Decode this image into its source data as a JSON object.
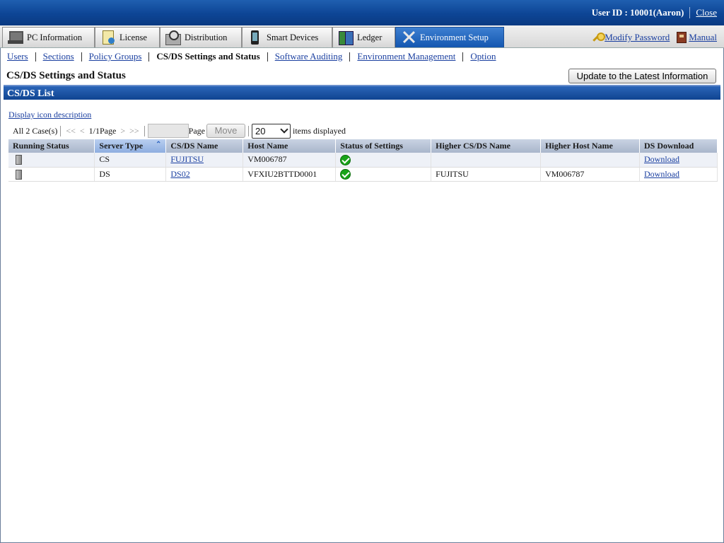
{
  "header": {
    "user_label": "User ID :",
    "user_value": "10001(Aaron)",
    "close_label": "Close"
  },
  "tabs": [
    {
      "label": "PC Information",
      "icon": "pc-icon"
    },
    {
      "label": "License",
      "icon": "license-icon"
    },
    {
      "label": "Distribution",
      "icon": "distribution-icon"
    },
    {
      "label": "Smart Devices",
      "icon": "smart-device-icon"
    },
    {
      "label": "Ledger",
      "icon": "ledger-icon"
    },
    {
      "label": "Environment Setup",
      "icon": "tools-icon",
      "active": true
    }
  ],
  "toplinks": {
    "modify_password": "Modify Password",
    "manual": "Manual"
  },
  "submenu": {
    "users": "Users",
    "sections": "Sections",
    "policy_groups": "Policy Groups",
    "current": "CS/DS Settings and Status",
    "software_auditing": "Software Auditing",
    "environment_management": "Environment Management",
    "option": "Option"
  },
  "page": {
    "title": "CS/DS Settings and Status",
    "update_button": "Update to the Latest Information",
    "section_title": "CS/DS List",
    "icon_desc_link": "Display icon description"
  },
  "paging": {
    "total": "All 2 Case(s)",
    "first": "<<",
    "prev": "<",
    "page_info": "1/1Page",
    "next": ">",
    "last": ">>",
    "page_input_value": "",
    "page_label": "Page",
    "move_button": "Move",
    "per_page_selected": "20",
    "items_label": "items displayed"
  },
  "table": {
    "columns": [
      "Running Status",
      "Server Type",
      "CS/DS Name",
      "Host Name",
      "Status of Settings",
      "Higher CS/DS Name",
      "Higher Host Name",
      "DS Download"
    ],
    "sorted_column": "Server Type",
    "rows": [
      {
        "server_type": "CS",
        "name": "FUJITSU",
        "host": "VM006787",
        "higher_name": "",
        "higher_host": "",
        "download": "Download"
      },
      {
        "server_type": "DS",
        "name": "DS02",
        "host": "VFXIU2BTTD0001",
        "higher_name": "FUJITSU",
        "higher_host": "VM006787",
        "download": "Download"
      }
    ]
  },
  "colors": {
    "header_blue": "#0d4595",
    "link_blue": "#1a3fa0",
    "status_ok": "#19a319"
  }
}
